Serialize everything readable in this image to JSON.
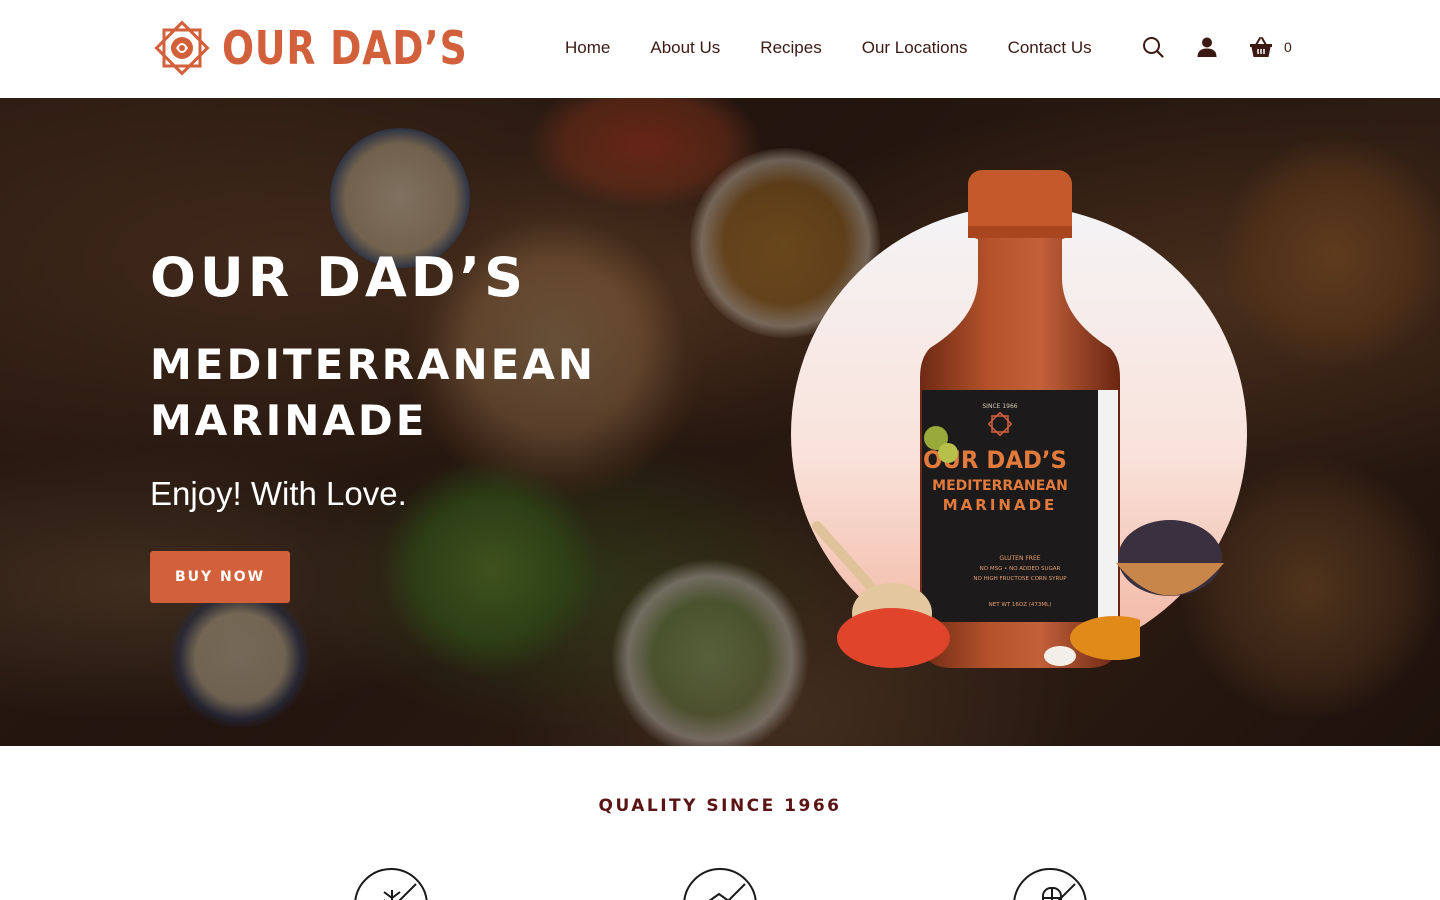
{
  "brand": {
    "name": "OUR DAD’S",
    "accent_color": "#d2603a",
    "dark_color": "#3b1a14"
  },
  "nav": {
    "items": [
      {
        "label": "Home"
      },
      {
        "label": "About Us"
      },
      {
        "label": "Recipes"
      },
      {
        "label": "Our Locations"
      },
      {
        "label": "Contact Us"
      }
    ]
  },
  "header_icons": {
    "search": "search-icon",
    "account": "user-icon",
    "cart": "basket-icon",
    "cart_count": "0"
  },
  "hero": {
    "title": "OUR DAD’S",
    "subtitle": "MEDITERRANEAN MARINADE",
    "tagline": "Enjoy! With Love.",
    "cta_label": "BUY NOW",
    "product": {
      "since": "SINCE 1966",
      "brand_line": "OUR DAD’S",
      "name_line1": "MEDITERRANEAN",
      "name_line2": "MARINADE",
      "claims": [
        "GLUTEN FREE",
        "NO MSG • NO ADDED SUGAR",
        "NO HIGH FRUCTOSE CORN SYRUP"
      ],
      "net_wt": "NET WT 16OZ (473ML)"
    }
  },
  "quality": {
    "title": "QUALITY SINCE 1966",
    "badges": [
      "no-gluten-icon",
      "no-sugar-icon",
      "no-corn-syrup-icon"
    ]
  }
}
